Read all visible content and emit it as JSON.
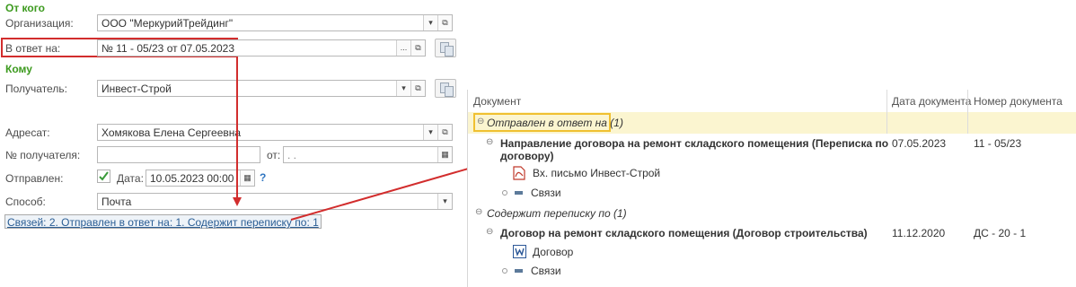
{
  "from_section": {
    "title": "От кого"
  },
  "organization": {
    "label": "Организация:",
    "value": "ООО \"МеркурийТрейдинг\""
  },
  "reply_to": {
    "label": "В ответ на:",
    "value": "№ 11 - 05/23 от 07.05.2023",
    "ellipsis": "..."
  },
  "to_section": {
    "title": "Кому"
  },
  "recipient": {
    "label": "Получатель:",
    "value": "Инвест-Строй"
  },
  "addressee": {
    "label": "Адресат:",
    "value": "Хомякова Елена Сергеевна"
  },
  "recipient_number": {
    "label": "№ получателя:",
    "value": "",
    "from_label": "от:",
    "date_placeholder": " .  ."
  },
  "sent": {
    "label": "Отправлен:",
    "checked": true,
    "date_label": "Дата:",
    "date_value": "10.05.2023 00:00",
    "help": "?"
  },
  "method": {
    "label": "Способ:",
    "value": "Почта"
  },
  "links_summary": {
    "text": "Связей: 2. Отправлен в ответ на: 1. Содержит переписку по: 1"
  },
  "colors": {
    "section_green": "#3c9a1e",
    "highlight_red": "#d22d2d",
    "group_yellow": "#fbf5d0"
  },
  "panel": {
    "columns": [
      "Документ",
      "Дата документа",
      "Номер документа"
    ],
    "rows": [
      {
        "kind": "group",
        "text": "Отправлен в ответ на (1)"
      },
      {
        "kind": "doc",
        "text": "Направление договора на ремонт складского помещения (Переписка по",
        "text2": "договору)",
        "date": "07.05.2023",
        "number": "11 - 05/23"
      },
      {
        "kind": "file",
        "icon": "pdf-icon",
        "text": "Вх. письмо Инвест-Строй"
      },
      {
        "kind": "links",
        "text": "Связи"
      },
      {
        "kind": "group2",
        "text": "Содержит переписку по (1)"
      },
      {
        "kind": "doc",
        "text": "Договор на ремонт складского помещения (Договор строительства)",
        "date": "11.12.2020",
        "number": "ДС - 20 - 1"
      },
      {
        "kind": "file",
        "icon": "word-icon",
        "text": "Договор"
      },
      {
        "kind": "links",
        "text": "Связи"
      }
    ]
  }
}
